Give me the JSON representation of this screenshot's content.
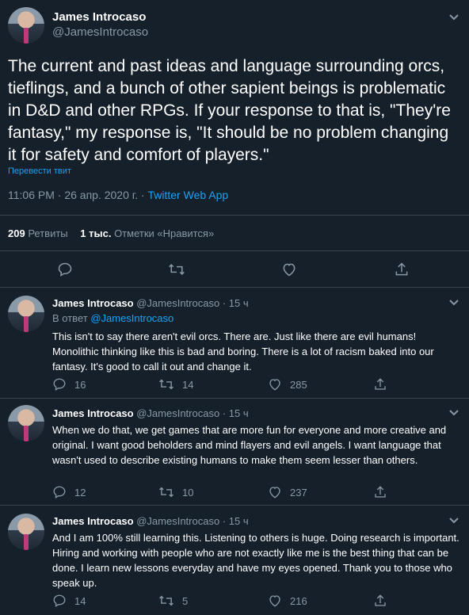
{
  "main_tweet": {
    "name": "James Introcaso",
    "handle": "@JamesIntrocaso",
    "text": "The current and past ideas and language surrounding orcs, tieflings, and a bunch of other sapient beings is problematic in D&D and other RPGs. If your response to that is, \"They're fantasy,\" my response is, \"It should be no problem changing it for safety and comfort of players.\"",
    "translate_link": "Перевести твит",
    "timestamp": "11:06 PM · 26 апр. 2020 г. · ",
    "source": "Twitter Web App",
    "retweets_count": "209",
    "retweets_label": "Ретвиты",
    "likes_count": "1 тыс.",
    "likes_label": "Отметки «Нравится»"
  },
  "replies": [
    {
      "name": "James Introcaso",
      "meta": "@JamesIntrocaso · 15 ч",
      "reply_to_prefix": "В ответ ",
      "reply_to_handle": "@JamesIntrocaso",
      "text": "This isn't to say there aren't evil orcs. There are. Just like there are evil humans! Monolithic thinking like this is bad and boring. There is a lot of racism baked into our fantasy. It's good to call it out and change it.",
      "replies": "16",
      "retweets": "14",
      "likes": "285"
    },
    {
      "name": "James Introcaso",
      "meta": "@JamesIntrocaso · 15 ч",
      "text": "When we do that, we get games that are more fun for everyone and more creative and original. I want good beholders and mind flayers and evil angels. I want language that wasn't used to describe existing humans to make them seem lesser than others.",
      "replies": "12",
      "retweets": "10",
      "likes": "237"
    },
    {
      "name": "James Introcaso",
      "meta": "@JamesIntrocaso · 15 ч",
      "text": "And I am 100% still learning this. Listening to others is huge. Doing research is important. Hiring and working with people who are not exactly like me is the best thing that can be done. I learn new lessons everyday and have my eyes opened. Thank you to those who speak up.",
      "replies": "14",
      "retweets": "5",
      "likes": "216"
    }
  ]
}
